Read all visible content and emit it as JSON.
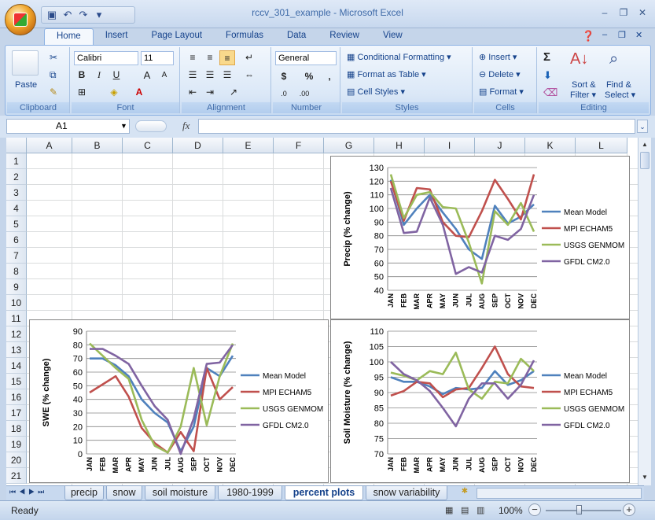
{
  "window": {
    "title": "rccv_301_example - Microsoft Excel"
  },
  "tabs": [
    "Home",
    "Insert",
    "Page Layout",
    "Formulas",
    "Data",
    "Review",
    "View"
  ],
  "ribbon": {
    "clipboard": {
      "label": "Clipboard",
      "paste": "Paste"
    },
    "font": {
      "label": "Font",
      "family": "Calibri",
      "size": "11",
      "bold": "B",
      "italic": "I",
      "underline": "U"
    },
    "alignment": {
      "label": "Alignment"
    },
    "number": {
      "label": "Number",
      "format": "General",
      "currency": "$",
      "percent": "%",
      "comma": ","
    },
    "styles": {
      "label": "Styles",
      "conditional": "Conditional Formatting",
      "table": "Format as Table",
      "cell": "Cell Styles"
    },
    "cells": {
      "label": "Cells",
      "insert": "Insert",
      "delete": "Delete",
      "format": "Format"
    },
    "editing": {
      "label": "Editing",
      "sum": "Σ",
      "sort": "Sort &",
      "filter": "Filter",
      "find": "Find &",
      "select": "Select"
    }
  },
  "formula_bar": {
    "name_box": "A1",
    "fx": "fx",
    "value": ""
  },
  "columns": [
    "A",
    "B",
    "C",
    "D",
    "E",
    "F",
    "G",
    "H",
    "I",
    "J",
    "K",
    "L"
  ],
  "rows": [
    "1",
    "2",
    "3",
    "4",
    "5",
    "6",
    "7",
    "8",
    "9",
    "10",
    "11",
    "12",
    "13",
    "14",
    "15",
    "16",
    "17",
    "18",
    "19",
    "20",
    "21"
  ],
  "sheet_tabs": [
    "precip",
    "snow",
    "soil moisture",
    "1980-1999",
    "percent plots",
    "snow variability"
  ],
  "status": {
    "ready": "Ready",
    "zoom": "100%"
  },
  "chart_data": [
    {
      "type": "line",
      "ylabel": "Precip (% change)",
      "ylim": [
        40,
        130
      ],
      "yticks": [
        40,
        50,
        60,
        70,
        80,
        90,
        100,
        110,
        120,
        130
      ],
      "categories": [
        "JAN",
        "FEB",
        "MAR",
        "APR",
        "MAY",
        "JUN",
        "JUL",
        "AUG",
        "SEP",
        "OCT",
        "NOV",
        "DEC"
      ],
      "series": [
        {
          "name": "Mean Model",
          "color": "#4f81bd",
          "values": [
            121,
            88,
            100,
            110,
            97,
            85,
            70,
            63,
            102,
            89,
            94,
            103
          ]
        },
        {
          "name": "MPI ECHAM5",
          "color": "#c0504d",
          "values": [
            120,
            91,
            115,
            114,
            90,
            80,
            79,
            98,
            121,
            107,
            92,
            125
          ]
        },
        {
          "name": "USGS GENMOM",
          "color": "#9bbb59",
          "values": [
            125,
            93,
            110,
            112,
            101,
            100,
            75,
            45,
            98,
            88,
            104,
            83
          ]
        },
        {
          "name": "GFDL CM2.0",
          "color": "#8064a2",
          "values": [
            115,
            82,
            83,
            108,
            88,
            52,
            57,
            53,
            80,
            77,
            85,
            110
          ]
        }
      ]
    },
    {
      "type": "line",
      "ylabel": "SWE (% change)",
      "ylim": [
        0,
        90
      ],
      "yticks": [
        0,
        10,
        20,
        30,
        40,
        50,
        60,
        70,
        80,
        90
      ],
      "categories": [
        "JAN",
        "FEB",
        "MAR",
        "APR",
        "MAY",
        "JUN",
        "JUL",
        "AUG",
        "SEP",
        "OCT",
        "NOV",
        "DEC"
      ],
      "series": [
        {
          "name": "Mean Model",
          "color": "#4f81bd",
          "values": [
            70,
            70,
            65,
            57,
            40,
            30,
            23,
            2,
            20,
            63,
            57,
            72
          ]
        },
        {
          "name": "MPI ECHAM5",
          "color": "#c0504d",
          "values": [
            45,
            51,
            57,
            42,
            19,
            8,
            1,
            16,
            2,
            63,
            40,
            49
          ]
        },
        {
          "name": "USGS GENMOM",
          "color": "#9bbb59",
          "values": [
            81,
            72,
            63,
            55,
            25,
            6,
            1,
            20,
            63,
            21,
            57,
            81
          ]
        },
        {
          "name": "GFDL CM2.0",
          "color": "#8064a2",
          "values": [
            77,
            77,
            72,
            66,
            50,
            35,
            25,
            0,
            26,
            66,
            67,
            80
          ]
        }
      ]
    },
    {
      "type": "line",
      "ylabel": "Soil Moisture  (% change)",
      "ylim": [
        70,
        110
      ],
      "yticks": [
        70,
        75,
        80,
        85,
        90,
        95,
        100,
        105,
        110
      ],
      "categories": [
        "JAN",
        "FEB",
        "MAR",
        "APR",
        "MAY",
        "JUN",
        "JUL",
        "AUG",
        "SEP",
        "OCT",
        "NOV",
        "DEC"
      ],
      "series": [
        {
          "name": "Mean Model",
          "color": "#4f81bd",
          "values": [
            95,
            93.5,
            93.5,
            92,
            89.5,
            91.5,
            91,
            91.5,
            97,
            92.5,
            94,
            97
          ]
        },
        {
          "name": "MPI ECHAM5",
          "color": "#c0504d",
          "values": [
            89,
            90.5,
            93.5,
            93,
            88.5,
            91,
            91.5,
            98,
            105,
            96,
            92,
            91.5
          ]
        },
        {
          "name": "USGS GENMOM",
          "color": "#9bbb59",
          "values": [
            96.5,
            95.5,
            94,
            97,
            96,
            103,
            91,
            88,
            93.5,
            93,
            101,
            97
          ]
        },
        {
          "name": "GFDL CM2.0",
          "color": "#8064a2",
          "values": [
            100,
            96,
            94,
            90.5,
            85,
            79,
            88,
            93,
            93,
            88,
            92.5,
            100.5
          ]
        }
      ]
    }
  ]
}
